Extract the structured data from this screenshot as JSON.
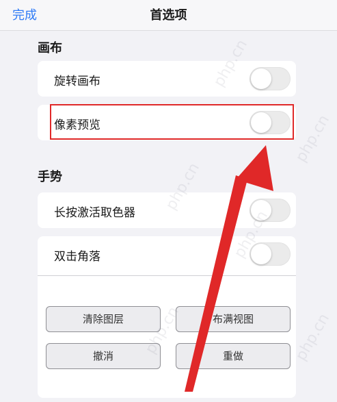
{
  "navbar": {
    "done_label": "完成",
    "title": "首选项"
  },
  "canvas_section": {
    "header": "画布",
    "rows": [
      {
        "label": "旋转画布",
        "on": false
      },
      {
        "label": "像素预览",
        "on": false
      }
    ]
  },
  "gesture_section": {
    "header": "手势",
    "rows": [
      {
        "label": "长按激活取色器",
        "on": false
      },
      {
        "label": "双击角落",
        "on": false
      }
    ],
    "buttons": {
      "clear_layer": "清除图层",
      "fill_view": "布满视图",
      "undo": "撤消",
      "redo": "重做"
    }
  },
  "watermark": "php.cn",
  "colors": {
    "accent": "#2f7bf6",
    "highlight": "#e02828",
    "arrow": "#e02828"
  }
}
